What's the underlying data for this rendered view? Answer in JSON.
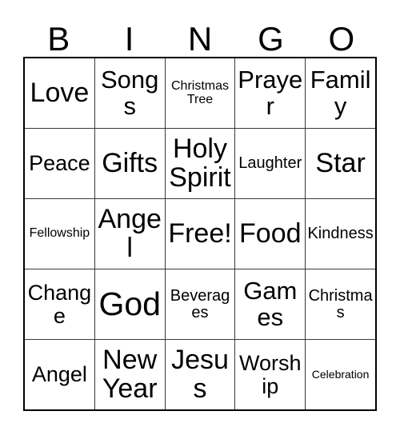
{
  "card": {
    "title": "Bingo Card",
    "background_color": "#ffffff",
    "text_color": "#000000",
    "border_color": "#000000",
    "grid_line_color": "#3a3a3a"
  },
  "header": {
    "letters": [
      {
        "label": "B"
      },
      {
        "label": "I"
      },
      {
        "label": "N"
      },
      {
        "label": "G"
      },
      {
        "label": "O"
      }
    ]
  },
  "grid": {
    "columns": 5,
    "rows": 5,
    "free_space": {
      "row": 2,
      "column": 2,
      "label": "Free!"
    },
    "cells": [
      [
        {
          "label": "Love",
          "size": "xl"
        },
        {
          "label": "Songs",
          "size": "lg"
        },
        {
          "label": "Christmas\nTree",
          "size": "xs"
        },
        {
          "label": "Prayer",
          "size": "lg"
        },
        {
          "label": "Family",
          "size": "lg"
        }
      ],
      [
        {
          "label": "Peace",
          "size": "md"
        },
        {
          "label": "Gifts",
          "size": "xl"
        },
        {
          "label": "Holy\nSpirit",
          "size": "xl"
        },
        {
          "label": "Laughter",
          "size": "sm"
        },
        {
          "label": "Star",
          "size": "xl"
        }
      ],
      [
        {
          "label": "Fellowship",
          "size": "xs"
        },
        {
          "label": "Angel",
          "size": "xl"
        },
        {
          "label": "Free!",
          "size": "xl"
        },
        {
          "label": "Food",
          "size": "xl"
        },
        {
          "label": "Kindness",
          "size": "sm"
        }
      ],
      [
        {
          "label": "Change",
          "size": "md"
        },
        {
          "label": "God",
          "size": "xxl"
        },
        {
          "label": "Beverages",
          "size": "sm"
        },
        {
          "label": "Games",
          "size": "lg"
        },
        {
          "label": "Christmas",
          "size": "sm"
        }
      ],
      [
        {
          "label": "Angel",
          "size": "md"
        },
        {
          "label": "New\nYear",
          "size": "xl"
        },
        {
          "label": "Jesus",
          "size": "xl"
        },
        {
          "label": "Worship",
          "size": "md"
        },
        {
          "label": "Celebration",
          "size": "xxs"
        }
      ]
    ]
  }
}
